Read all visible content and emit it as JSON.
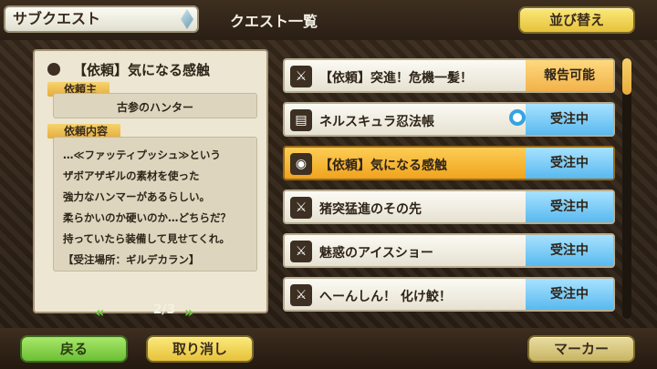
{
  "header": {
    "breadcrumb": "サブクエスト",
    "title": "クエスト一覧",
    "sort_button": "並び替え"
  },
  "detail": {
    "quest_title": "【依頼】気になる感触",
    "client_label": "依頼主",
    "client_name": "古参のハンター",
    "content_label": "依頼内容",
    "description_lines": [
      "…≪ファッティプッシュ≫という",
      "ザボアザギルの素材を使った",
      "強力なハンマーがあるらしい。",
      "柔らかいのか硬いのか…どちらだ？",
      "持っていたら装備して見せてくれ。",
      "【受注場所：ギルデカラン】"
    ],
    "page_indicator": "2/3"
  },
  "quests": [
    {
      "name": "【依頼】突進！危機一髪！",
      "status": "報告可能",
      "icon": "sword-icon"
    },
    {
      "name": "ネルスキュラ忍法帳",
      "status": "受注中",
      "icon": "scroll-icon",
      "pin": true
    },
    {
      "name": "【依頼】気になる感触",
      "status": "受注中",
      "icon": "item-icon",
      "selected": true
    },
    {
      "name": "猪突猛進のその先",
      "status": "受注中",
      "icon": "sword-icon"
    },
    {
      "name": "魅惑のアイスショー",
      "status": "受注中",
      "icon": "sword-icon"
    },
    {
      "name": "へーんしん！ 化け鮫！",
      "status": "受注中",
      "icon": "sword-icon"
    }
  ],
  "footer": {
    "back": "戻る",
    "cancel": "取り消し",
    "marker": "マーカー"
  },
  "colors": {
    "accepted_status": "#58b9ef",
    "report_status": "#f2b24a",
    "selected_row": "#f0a41e"
  }
}
